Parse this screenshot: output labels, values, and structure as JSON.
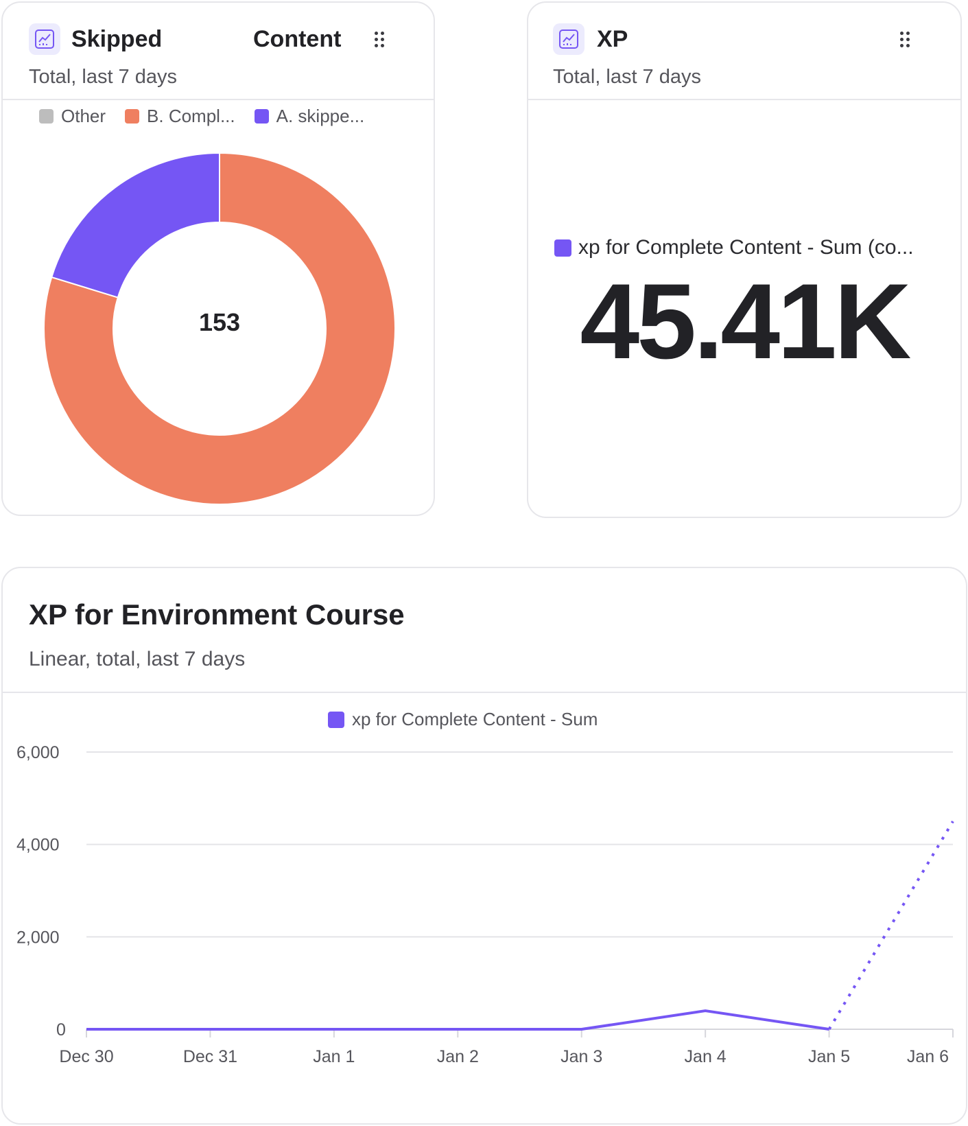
{
  "cards": {
    "skipped": {
      "title_left": "Skipped",
      "title_right": "Content",
      "subtitle": "Total, last 7 days",
      "icon": "line-chart-icon",
      "center_value": "153",
      "legend": [
        {
          "label": "Other",
          "color": "#bdbdbd"
        },
        {
          "label": "B. Compl...",
          "color": "#ef7f60"
        },
        {
          "label": "A. skippe...",
          "color": "#7556f4"
        }
      ]
    },
    "xp": {
      "title": "XP",
      "subtitle": "Total, last 7 days",
      "icon": "line-chart-icon",
      "metric_label": "xp for Complete Content - Sum (co...",
      "metric_color": "#7556f4",
      "value": "45.41K"
    },
    "environment": {
      "title": "XP for Environment Course",
      "subtitle": "Linear, total, last 7 days",
      "legend": {
        "label": "xp for Complete Content - Sum",
        "color": "#7556f4"
      }
    }
  },
  "chart_data": [
    {
      "type": "pie",
      "subtype": "donut",
      "title": "Skipped Content",
      "total": 153,
      "categories": [
        "Other",
        "B. Compl...",
        "A. skippe..."
      ],
      "values": [
        0,
        122,
        31
      ],
      "colors": [
        "#bdbdbd",
        "#ef7f60",
        "#7556f4"
      ]
    },
    {
      "type": "line",
      "title": "XP for Environment Course",
      "x": [
        "Dec 30",
        "Dec 31",
        "Jan 1",
        "Jan 2",
        "Jan 3",
        "Jan 4",
        "Jan 5",
        "Jan 6"
      ],
      "series": [
        {
          "name": "xp for Complete Content - Sum",
          "color": "#7556f4",
          "values": [
            0,
            0,
            0,
            0,
            0,
            400,
            0,
            4500
          ],
          "dotted_from_index": 6
        }
      ],
      "ylim": [
        0,
        6000
      ],
      "yticks": [
        "0",
        "2,000",
        "4,000",
        "6,000"
      ],
      "grid": true,
      "legend_position": "top-center"
    }
  ]
}
